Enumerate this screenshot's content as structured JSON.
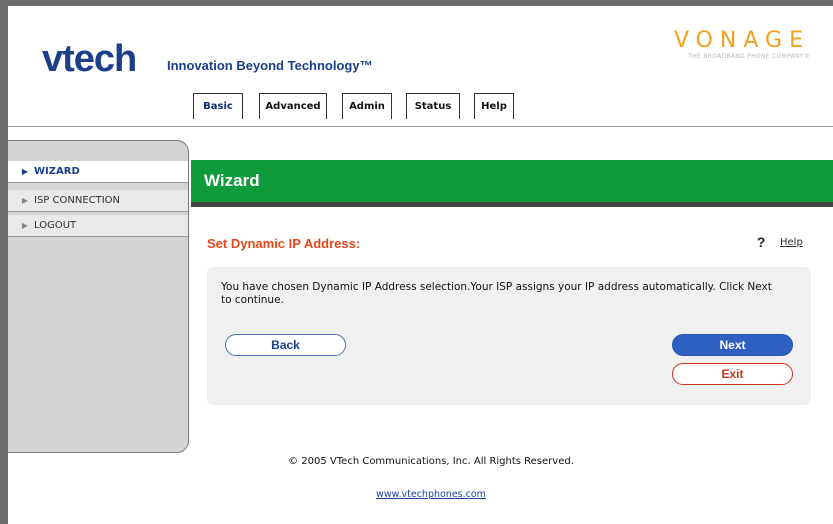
{
  "header": {
    "logo_text": "vtech",
    "tagline": "Innovation Beyond Technology™",
    "partner_name": "VONAGE",
    "partner_tagline": "THE BROADBAND PHONE COMPANY®"
  },
  "tabs": [
    {
      "label": "Basic",
      "active": true
    },
    {
      "label": "Advanced",
      "active": false
    },
    {
      "label": "Admin",
      "active": false
    },
    {
      "label": "Status",
      "active": false
    },
    {
      "label": "Help",
      "active": false
    }
  ],
  "sidebar": {
    "items": [
      {
        "label": "WIZARD",
        "active": true
      },
      {
        "label": "ISP CONNECTION",
        "active": false
      },
      {
        "label": "LOGOUT",
        "active": false
      }
    ]
  },
  "banner": {
    "title": "Wizard"
  },
  "content": {
    "section_title": "Set Dynamic IP Address:",
    "help_symbol": "?",
    "help_label": "Help",
    "message": "You have chosen Dynamic IP Address selection.Your ISP assigns your IP address automatically. Click Next to continue.",
    "back_label": "Back",
    "next_label": "Next",
    "exit_label": "Exit"
  },
  "footer": {
    "copyright": "© 2005 VTech Communications, Inc. All Rights Reserved.",
    "link": "www.vtechphones.com"
  },
  "colors": {
    "brand_blue": "#1b3f8b",
    "banner_green": "#0f9b3c",
    "title_orange": "#e7461b",
    "vonage_orange": "#f2a11e",
    "next_button_blue": "#2f5fc0",
    "exit_red": "#c8341f"
  }
}
